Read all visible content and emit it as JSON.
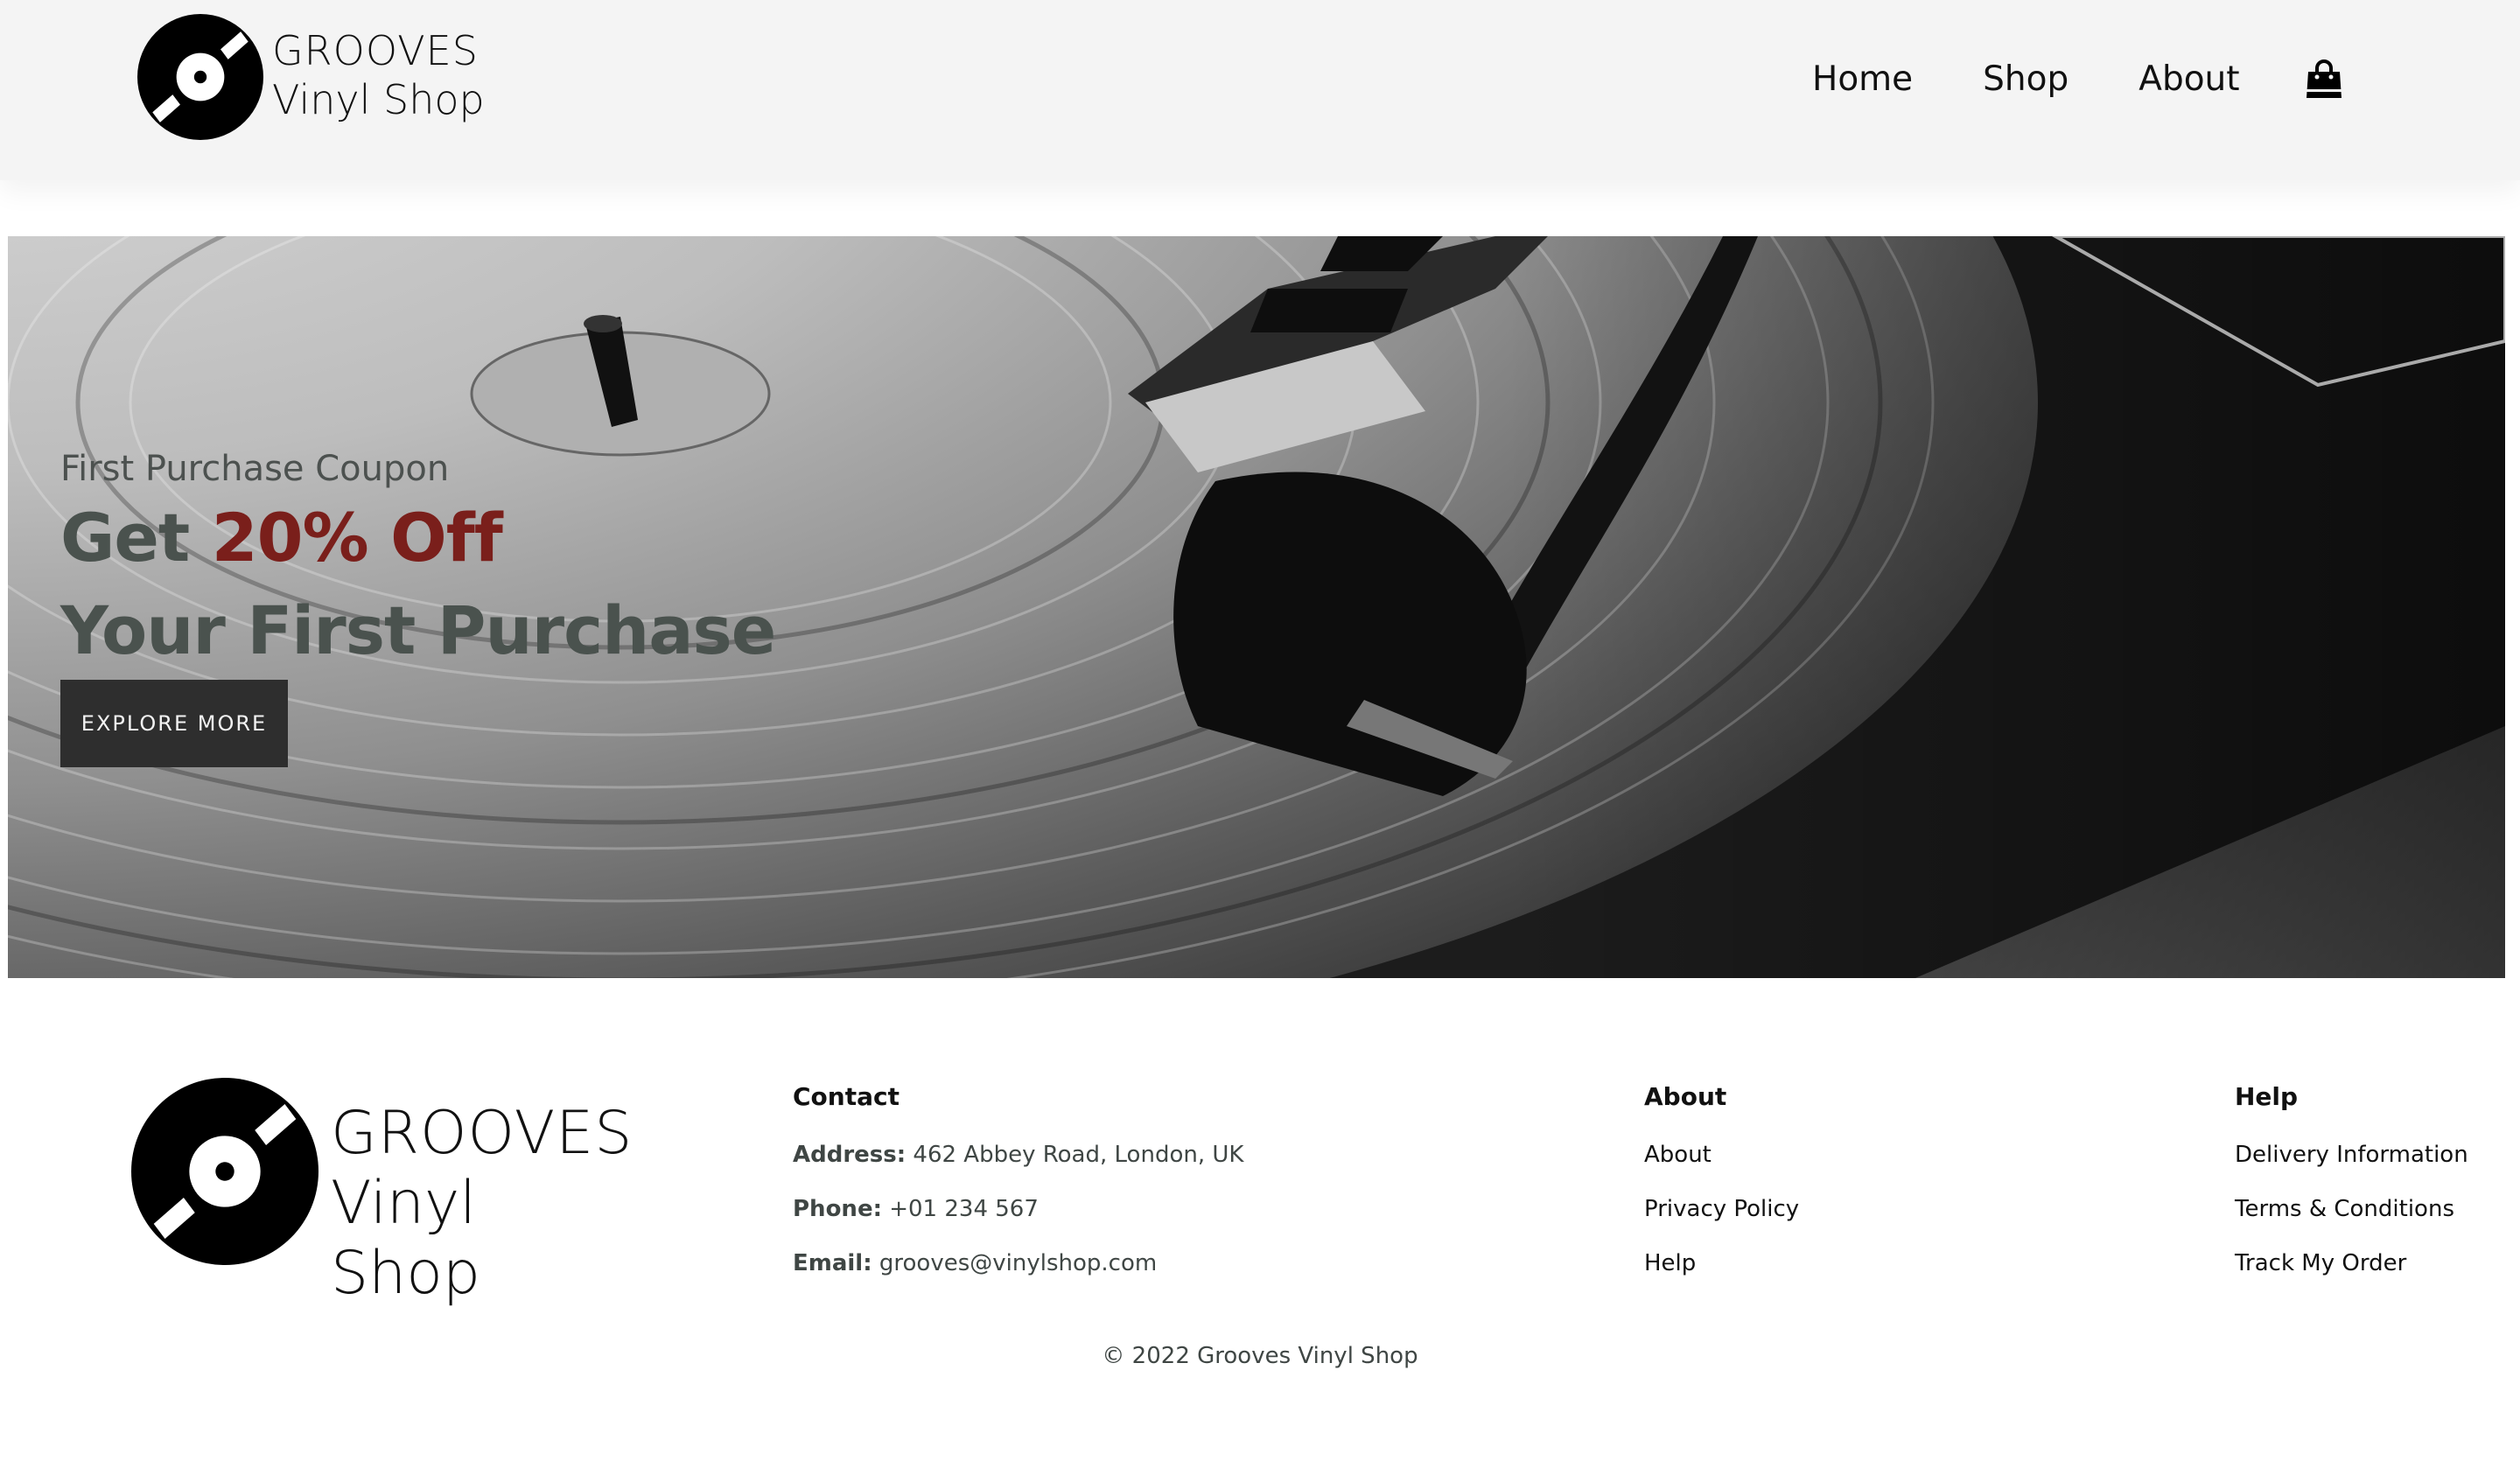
{
  "brand": {
    "line1": "GROOVES",
    "line2": "Vinyl Shop"
  },
  "nav": {
    "items": [
      {
        "label": "Home"
      },
      {
        "label": "Shop"
      },
      {
        "label": "About"
      }
    ],
    "cart_icon": "shopping-bag-icon"
  },
  "hero": {
    "kicker": "First Purchase Coupon",
    "headline_prefix": "Get ",
    "headline_highlight": "20% Off",
    "headline_line2": "Your First Purchase",
    "cta_label": "EXPLORE MORE",
    "highlight_color": "#7a1f1b",
    "headline_color": "#4a524e"
  },
  "footer": {
    "contact": {
      "heading": "Contact",
      "address_label": "Address:",
      "address_value": " 462 Abbey Road, London, UK",
      "phone_label": "Phone:",
      "phone_value": " +01 234 567",
      "email_label": "Email:",
      "email_value": " grooves@vinylshop.com"
    },
    "about": {
      "heading": "About",
      "links": [
        "About",
        "Privacy Policy",
        "Help"
      ]
    },
    "help": {
      "heading": "Help",
      "links": [
        "Delivery Information",
        "Terms & Conditions",
        "Track My Order"
      ]
    },
    "copyright": "© 2022 Grooves Vinyl Shop"
  }
}
